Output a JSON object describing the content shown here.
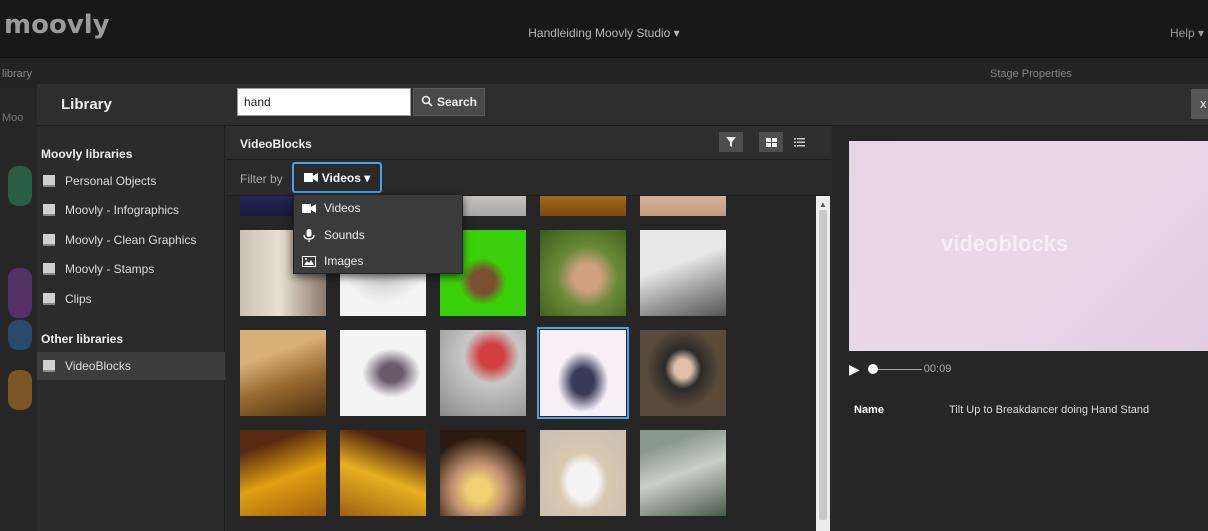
{
  "app": {
    "logo": "moovly",
    "project_title": "Handleiding Moovly Studio ▾",
    "help": "Help ▾",
    "bg_library": "library",
    "bg_stage": "Stage Properties",
    "bg_moo": "Moo"
  },
  "modal": {
    "title": "Library",
    "search": {
      "value": "hand",
      "button": "Search"
    },
    "close": "x"
  },
  "sidebar": {
    "moovly_heading": "Moovly libraries",
    "moovly_items": [
      {
        "label": "Personal Objects"
      },
      {
        "label": "Moovly - Infographics"
      },
      {
        "label": "Moovly - Clean Graphics"
      },
      {
        "label": "Moovly - Stamps"
      },
      {
        "label": "Clips"
      }
    ],
    "other_heading": "Other libraries",
    "other_items": [
      {
        "label": "VideoBlocks",
        "active": true
      }
    ]
  },
  "center": {
    "title": "VideoBlocks",
    "filter_label": "Filter by",
    "filter_selected": "Videos ▾",
    "dropdown": [
      {
        "label": "Videos",
        "icon": "video-camera-icon"
      },
      {
        "label": "Sounds",
        "icon": "microphone-icon"
      },
      {
        "label": "Images",
        "icon": "image-icon"
      }
    ],
    "thumbnails": [
      {
        "desc": "clip-partial-1"
      },
      {
        "desc": "clip-partial-2"
      },
      {
        "desc": "clip-partial-3"
      },
      {
        "desc": "clip-partial-4"
      },
      {
        "desc": "clip-partial-5"
      },
      {
        "desc": "hand-on-railing"
      },
      {
        "desc": "skeleton-hand"
      },
      {
        "desc": "ok-hand-green-screen"
      },
      {
        "desc": "hand-grass"
      },
      {
        "desc": "hand-tablet"
      },
      {
        "desc": "cutting-board"
      },
      {
        "desc": "man-dancing"
      },
      {
        "desc": "girl-umbrella"
      },
      {
        "desc": "breakdancer-hand-stand",
        "selected": true
      },
      {
        "desc": "man-coffee"
      },
      {
        "desc": "children-yellow-1"
      },
      {
        "desc": "children-yellow-2"
      },
      {
        "desc": "hands-flower"
      },
      {
        "desc": "child-white"
      },
      {
        "desc": "faucet"
      }
    ]
  },
  "preview": {
    "watermark": "videoblocks",
    "time": "00:09",
    "name_label": "Name",
    "name_value": "Tilt Up to Breakdancer doing Hand Stand"
  }
}
